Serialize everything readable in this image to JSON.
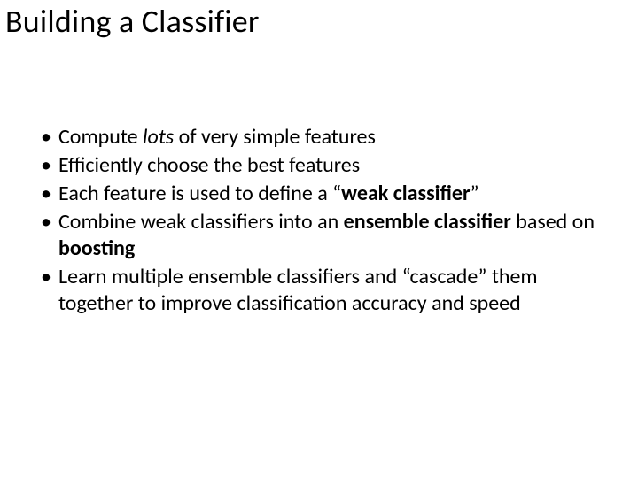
{
  "title": "Building a Classifier",
  "bullets": [
    {
      "segments": [
        {
          "t": "Compute "
        },
        {
          "t": "lots",
          "style": "i"
        },
        {
          "t": " of very simple features"
        }
      ]
    },
    {
      "segments": [
        {
          "t": "Efficiently choose the best features"
        }
      ]
    },
    {
      "segments": [
        {
          "t": "Each feature is used to define a “"
        },
        {
          "t": "weak classifier",
          "style": "b"
        },
        {
          "t": "”"
        }
      ]
    },
    {
      "segments": [
        {
          "t": "Combine weak classifiers into an "
        },
        {
          "t": "ensemble classifier",
          "style": "b"
        },
        {
          "t": " based on "
        },
        {
          "t": "boosting",
          "style": "b"
        }
      ]
    },
    {
      "segments": [
        {
          "t": "Learn multiple ensemble classifiers and “cascade” them together to improve classification accuracy and speed"
        }
      ]
    }
  ]
}
